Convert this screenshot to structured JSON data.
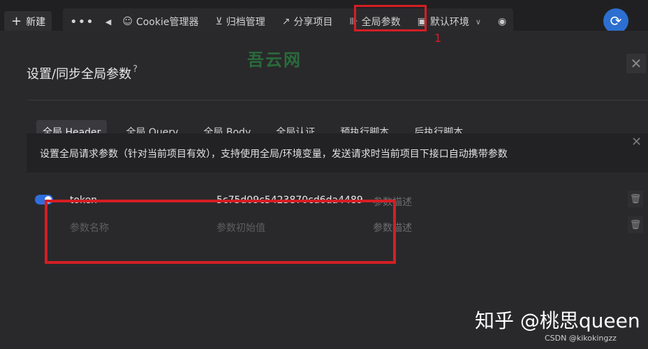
{
  "toolbar": {
    "new_label": "新建",
    "more_label": "•••",
    "back_label": "◀",
    "cookie_label": "Cookie管理器",
    "archive_label": "归档管理",
    "share_label": "分享项目",
    "global_params_label": "全局参数",
    "env_label": "默认环境",
    "annotation_1": "1"
  },
  "icons": {
    "plus": "+",
    "cookie": "☺",
    "archive": "⊻",
    "share": "↗",
    "global": "⊪",
    "env": "▣",
    "caret": "∨",
    "eye": "◉",
    "sync": "⟳",
    "close": "✕",
    "trash": "🗑",
    "help": "?"
  },
  "watermark": "吾云网",
  "modal": {
    "title": "设置/同步全局参数",
    "tabs": [
      {
        "label": "全局 Header",
        "active": true
      },
      {
        "label": "全局 Query",
        "active": false
      },
      {
        "label": "全局 Body",
        "active": false
      },
      {
        "label": "全局认证",
        "active": false
      },
      {
        "label": "预执行脚本",
        "active": false
      },
      {
        "label": "后执行脚本",
        "active": false
      }
    ],
    "notice": "设置全局请求参数（针对当前项目有效），支持使用全局/环境变量，发送请求时当前项目下接口自动携带参数",
    "rows": [
      {
        "enabled": true,
        "name": "token",
        "value": "5c75d09c5423870cd6da4489",
        "description_placeholder": "参数描述"
      }
    ],
    "new_row": {
      "name_placeholder": "参数名称",
      "value_placeholder": "参数初始值",
      "description_placeholder": "参数描述"
    }
  },
  "footer": {
    "zhihu": "知乎 @桃思queen",
    "csdn": "CSDN @kikokingzz"
  },
  "colors": {
    "accent": "#2f6fdd",
    "highlight": "#d41e24",
    "background": "#29292c"
  }
}
